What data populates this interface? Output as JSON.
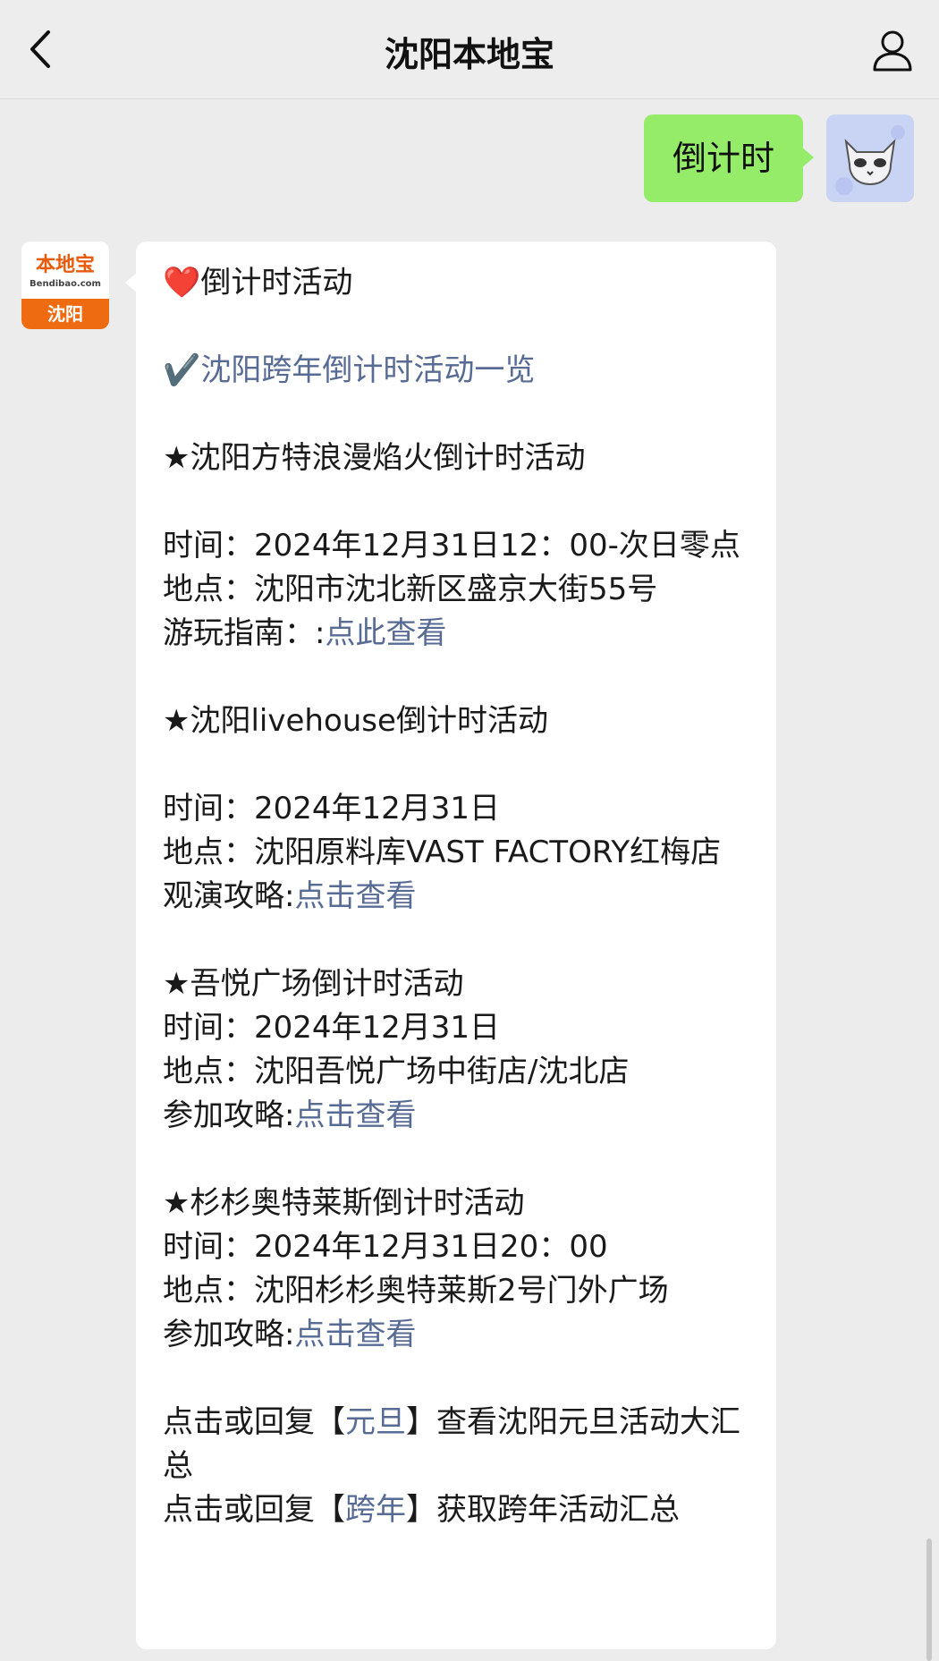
{
  "header": {
    "title": "沈阳本地宝"
  },
  "outgoing_message": {
    "text": "倒计时"
  },
  "bot": {
    "avatar_logo": "本地宝",
    "avatar_site": "Bendibao.com",
    "avatar_city": "沈阳"
  },
  "reply": {
    "heart_icon": "❤️",
    "section_title": "倒计时活动",
    "check_icon": "✔️",
    "overview_link": "沈阳跨年倒计时活动一览",
    "events": [
      {
        "title": "★沈阳方特浪漫焰火倒计时活动",
        "time": "时间：2024年12月31日12：00-次日零点",
        "place": "地点：沈阳市沈北新区盛京大街55号",
        "guide_label": "游玩指南：:",
        "guide_link": "点此查看"
      },
      {
        "title": "★沈阳livehouse倒计时活动",
        "time": "时间：2024年12月31日",
        "place": "地点：沈阳原料库VAST FACTORY红梅店",
        "guide_label": "观演攻略:",
        "guide_link": "点击查看"
      },
      {
        "title": "★吾悦广场倒计时活动",
        "time": "时间：2024年12月31日",
        "place": "地点：沈阳吾悦广场中街店/沈北店",
        "guide_label": "参加攻略:",
        "guide_link": "点击查看"
      },
      {
        "title": "★杉杉奥特莱斯倒计时活动",
        "time": "时间：2024年12月31日20：00",
        "place": "地点：沈阳杉杉奥特莱斯2号门外广场",
        "guide_label": "参加攻略:",
        "guide_link": "点击查看"
      }
    ],
    "footer": [
      {
        "prefix": "点击或回复【",
        "keyword": "元旦",
        "suffix": "】查看沈阳元旦活动大汇总"
      },
      {
        "prefix": "点击或回复【",
        "keyword": "跨年",
        "suffix": "】获取跨年活动汇总"
      }
    ]
  }
}
